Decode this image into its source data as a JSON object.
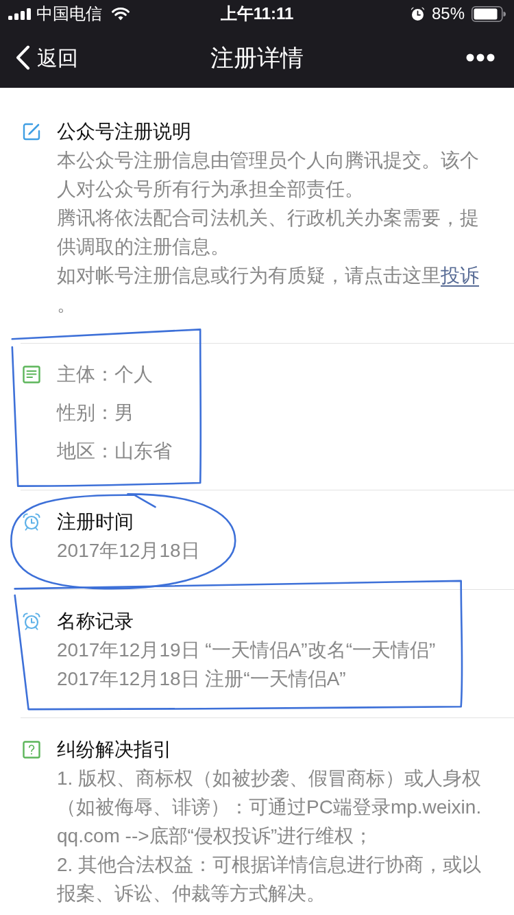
{
  "status_bar": {
    "carrier": "中国电信",
    "time": "上午11:11",
    "battery": "85%"
  },
  "nav_bar": {
    "back": "返回",
    "title": "注册详情"
  },
  "sections": [
    {
      "kind": "statement",
      "title": "公众号注册说明",
      "paragraphs": [
        {
          "text": "本公众号注册信息由管理员个人向腾讯提交。该个人对公众号所有行为承担全部责任。"
        },
        {
          "text": "腾讯将依法配合司法机关、行政机关办案需要，提供调取的注册信息。"
        },
        {
          "text": "如对帐号注册信息或行为有质疑，请点击这里",
          "link": "投诉",
          "tail": "。"
        }
      ]
    },
    {
      "kind": "profile",
      "rows": [
        {
          "label": "主体：",
          "value": "个人"
        },
        {
          "label": "性别：",
          "value": "男"
        },
        {
          "label": "地区：",
          "value": "山东省"
        }
      ],
      "annotation": {
        "kind": "box"
      }
    },
    {
      "kind": "date",
      "title": "注册时间",
      "paragraphs": [
        {
          "text": "2017年12月18日"
        }
      ],
      "annotation": {
        "kind": "ellipse"
      }
    },
    {
      "kind": "history",
      "title": "名称记录",
      "paragraphs": [
        {
          "text": "2017年12月19日 “一天情侣A”改名“一天情侣”"
        },
        {
          "text": "2017年12月18日 注册“一天情侣A”"
        }
      ],
      "annotation": {
        "kind": "box"
      }
    },
    {
      "kind": "guide",
      "title": "纠纷解决指引",
      "paragraphs": [
        {
          "text": "1. 版权、商标权（如被抄袭、假冒商标）或人身权（如被侮辱、诽谤）：可通过PC端登录mp.weixin.qq.com -->底部“侵权投诉”进行维权；"
        },
        {
          "text": "2. 其他合法权益：可根据详情信息进行协商，或以报案、诉讼、仲裁等方式解决。"
        }
      ]
    }
  ]
}
